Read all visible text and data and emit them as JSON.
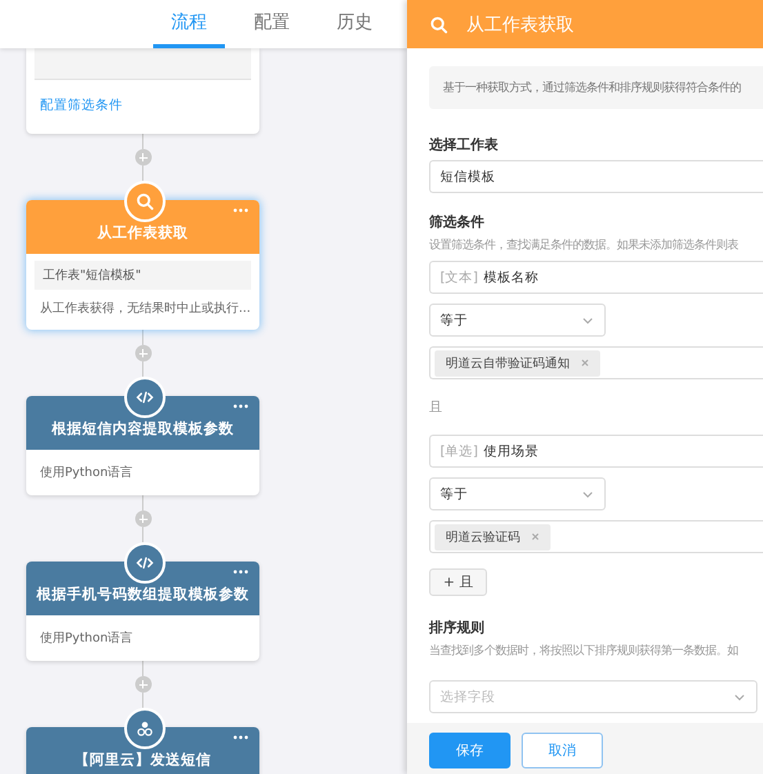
{
  "tabs": [
    {
      "label": "流程",
      "selected": true
    },
    {
      "label": "配置",
      "selected": false
    },
    {
      "label": "历史",
      "selected": false
    }
  ],
  "nodes": [
    {
      "kind": "partial",
      "link": "配置筛选条件"
    },
    {
      "kind": "search",
      "title": "从工作表获取",
      "selected": true,
      "detail": "工作表\"短信模板\"",
      "description": "从工作表获得，无结果时中止或执行..."
    },
    {
      "kind": "code",
      "title": "根据短信内容提取模板参数",
      "selected": false,
      "description": "使用Python语言"
    },
    {
      "kind": "code",
      "title": "根据手机号码数组提取模板参数",
      "selected": false,
      "description": "使用Python语言"
    },
    {
      "kind": "sms",
      "title": "【阿里云】发送短信",
      "selected": false
    }
  ],
  "panel": {
    "title": "从工作表获取",
    "intro": "基于一种获取方式，通过筛选条件和排序规则获得符合条件的",
    "form": [
      {
        "kind": "label",
        "text": "选择工作表"
      },
      {
        "kind": "field",
        "value": "短信模板"
      },
      {
        "kind": "label",
        "text": "筛选条件"
      },
      {
        "kind": "hint",
        "text": "设置筛选条件，查找满足条件的数据。如果未添加筛选条件则表"
      },
      {
        "kind": "field",
        "prefix": "[文本]",
        "value": "模板名称"
      },
      {
        "kind": "select",
        "value": "等于"
      },
      {
        "kind": "tags",
        "tags": [
          "明道云自带验证码通知"
        ]
      },
      {
        "kind": "conjunction",
        "text": "且"
      },
      {
        "kind": "field",
        "prefix": "[单选]",
        "value": "使用场景"
      },
      {
        "kind": "select",
        "value": "等于"
      },
      {
        "kind": "tags",
        "tags": [
          "明道云验证码"
        ]
      },
      {
        "kind": "add",
        "text": "+ 且"
      },
      {
        "kind": "label",
        "text": "排序规则"
      },
      {
        "kind": "hint",
        "text": "当查找到多个数据时，将按照以下排序规则获得第一条数据。如"
      },
      {
        "kind": "wideselect",
        "placeholder": "选择字段"
      }
    ],
    "buttons": [
      {
        "kind": "primary",
        "label": "保存"
      },
      {
        "kind": "secondary",
        "label": "取消"
      }
    ]
  }
}
